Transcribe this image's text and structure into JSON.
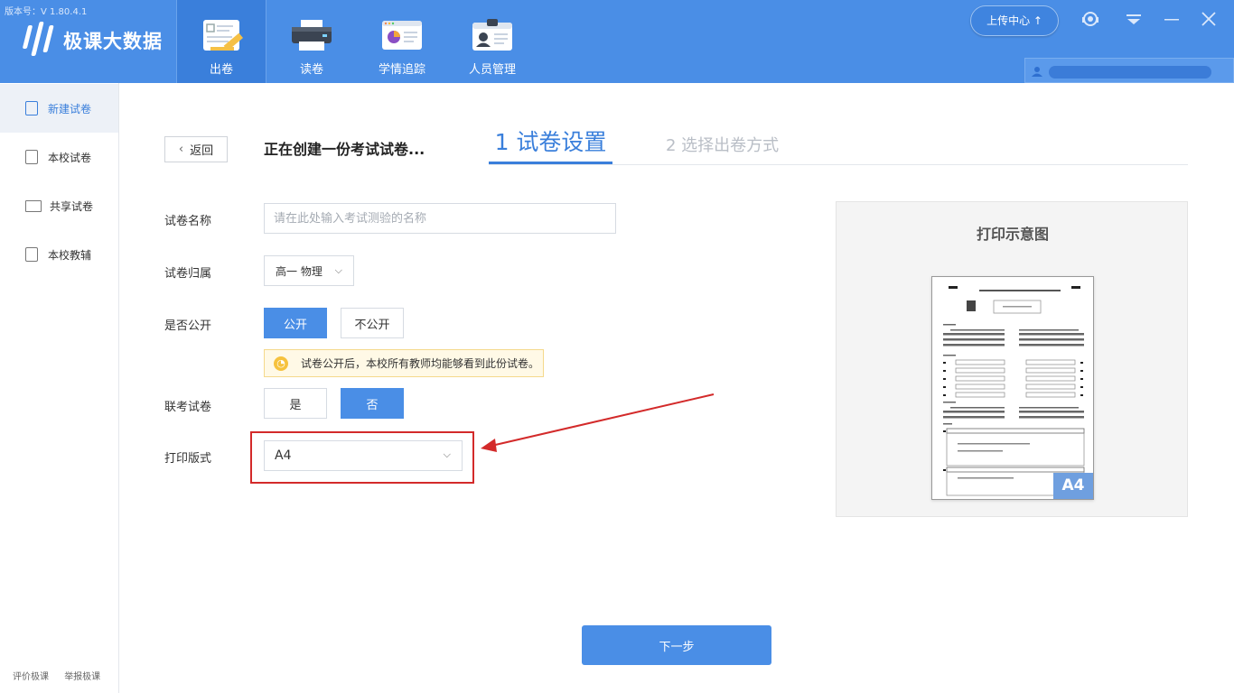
{
  "app": {
    "version": "版本号：V 1.80.4.1",
    "logo_text": "极课大数据"
  },
  "nav": {
    "tabs": [
      {
        "label": "出卷",
        "icon": "paper-ruler-icon"
      },
      {
        "label": "读卷",
        "icon": "scanner-icon"
      },
      {
        "label": "学情追踪",
        "icon": "chart-report-icon"
      },
      {
        "label": "人员管理",
        "icon": "id-badge-icon"
      }
    ],
    "active_tab": 0
  },
  "header": {
    "upload_label": "上传中心 ↑",
    "support_icon": "headset-icon",
    "dropdown_icon": "dropdown-menu-icon",
    "minimize_icon": "minimize-icon",
    "close_icon": "close-icon"
  },
  "sidebar": {
    "items": [
      {
        "label": "新建试卷",
        "icon": "new-doc-icon"
      },
      {
        "label": "本校试卷",
        "icon": "doc-icon"
      },
      {
        "label": "共享试卷",
        "icon": "book-icon"
      },
      {
        "label": "本校教辅",
        "icon": "clipboard-icon"
      }
    ],
    "footer": [
      "评价极课",
      "举报极课"
    ]
  },
  "main": {
    "back_label": "返回",
    "create_title": "正在创建一份考试试卷...",
    "step1": "1 试卷设置",
    "step2": "2 选择出卷方式",
    "form": {
      "name_label": "试卷名称",
      "name_placeholder": "请在此处输入考试测验的名称",
      "belong_label": "试卷归属",
      "belong_value": "高一 物理",
      "public_label": "是否公开",
      "public_yes": "公开",
      "public_no": "不公开",
      "public_tip": "试卷公开后，本校所有教师均能够看到此份试卷。",
      "joint_label": "联考试卷",
      "joint_yes": "是",
      "joint_no": "否",
      "print_label": "打印版式",
      "print_value": "A4"
    },
    "preview_title": "打印示意图",
    "preview_badge": "A4",
    "next_label": "下一步"
  },
  "colors": {
    "header_bg": "#4a8ee6",
    "accent": "#3a7fdb",
    "highlight": "#d32a2a",
    "tip_bg": "#fff9e6"
  }
}
